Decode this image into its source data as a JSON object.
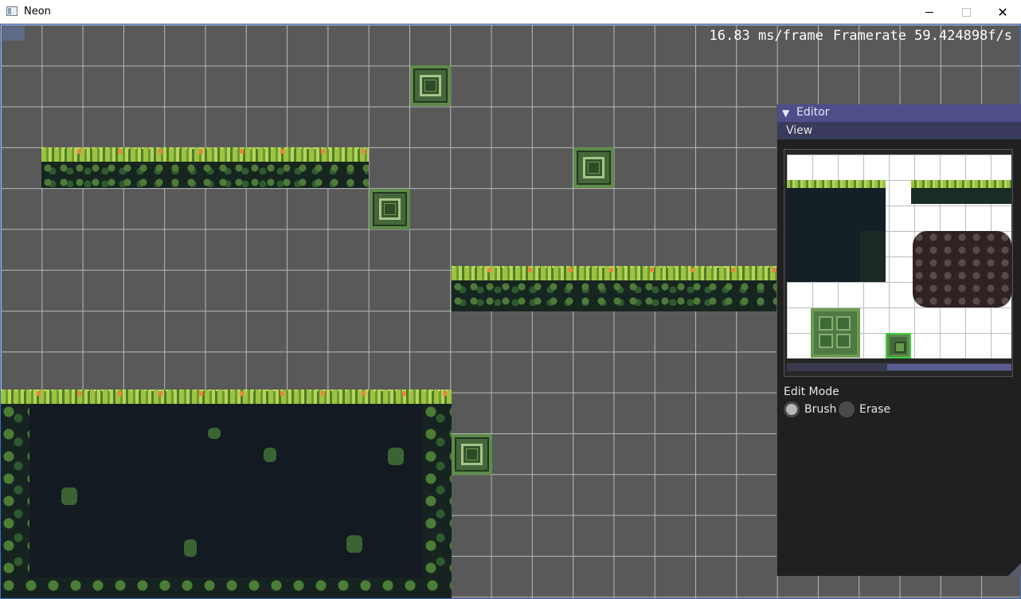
{
  "window": {
    "title": "Neon",
    "min_label": "",
    "close_glyph": "✕"
  },
  "hud": {
    "frame_time": "16.83 ms/frame",
    "framerate": "Framerate 59.424898f/s"
  },
  "editor": {
    "title": "Editor",
    "collapse_glyph": "▼",
    "menu": {
      "view": "View"
    },
    "edit_mode_label": "Edit Mode",
    "modes": [
      {
        "label": "Brush",
        "selected": true
      },
      {
        "label": "Erase",
        "selected": false
      }
    ]
  },
  "colors": {
    "viewport_bg": "#595959",
    "grid": "#b9b9b9",
    "editor_title_bg": "#4e4e8a",
    "selection": "#3dcf3d"
  }
}
